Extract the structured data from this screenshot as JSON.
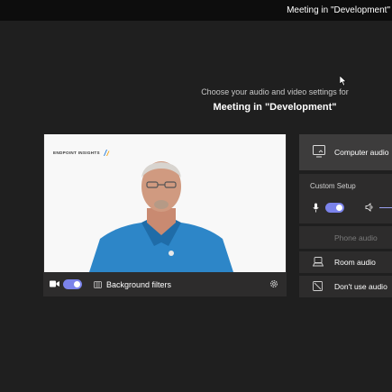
{
  "window": {
    "title": "Meeting in \"Development\""
  },
  "prompt": {
    "line1": "Choose your audio and video settings for",
    "meeting_name": "Meeting in \"Development\""
  },
  "video": {
    "brand_text": "ENDPOINT INSIGHTS",
    "camera_on": true,
    "background_filters_label": "Background filters"
  },
  "audio_options": {
    "computer_audio": "Computer audio",
    "custom_setup": "Custom Setup",
    "mic_on": true,
    "phone_audio": "Phone audio",
    "room_audio": "Room audio",
    "dont_use_audio": "Don't use audio"
  },
  "colors": {
    "accent": "#7b83eb",
    "background": "#1f1f1f",
    "panel": "#2d2c2c",
    "selected_panel": "#3d3c3c"
  }
}
